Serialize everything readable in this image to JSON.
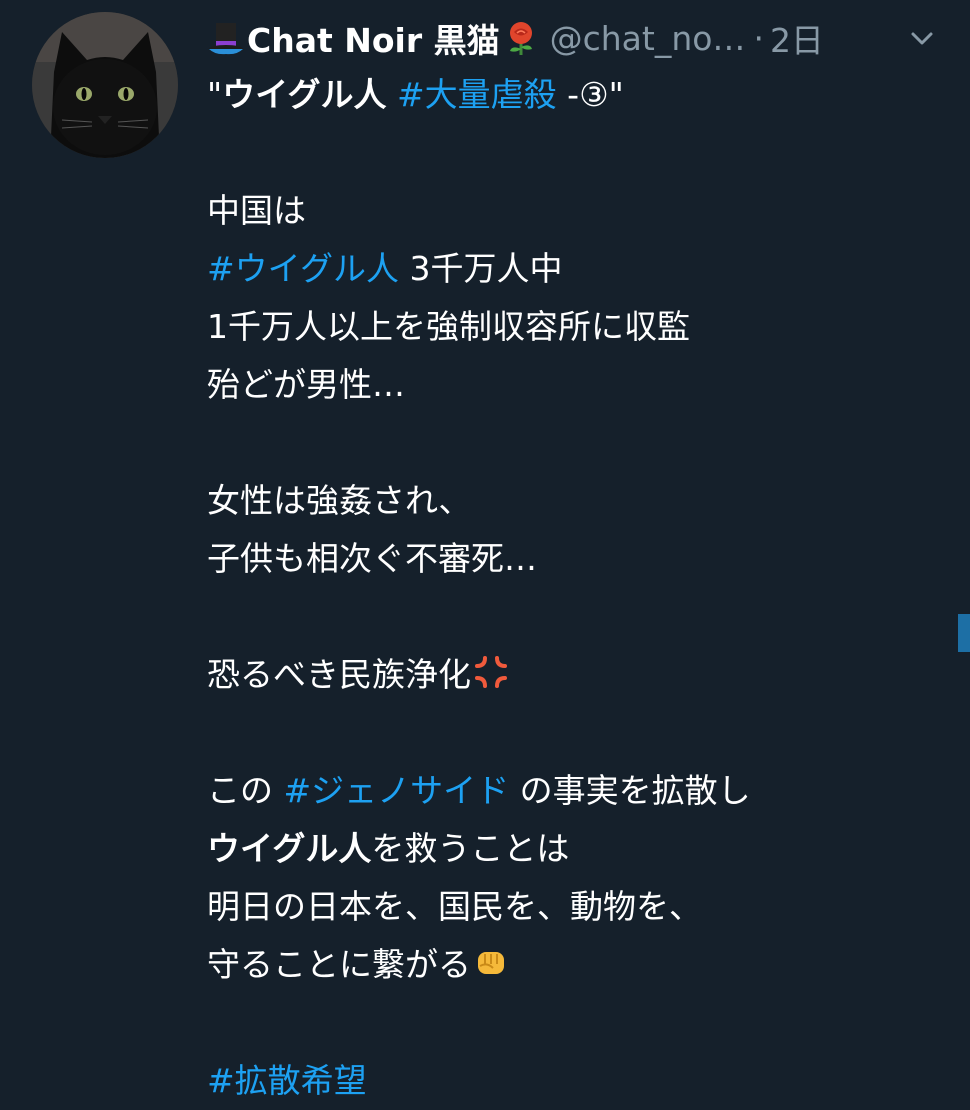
{
  "author": {
    "display_name": "Chat Noir 黒猫",
    "handle": "@chat_no…",
    "separator": "·",
    "time": "2日",
    "hat_icon": "top-hat-icon",
    "rose_icon": "rose-icon"
  },
  "tweet": {
    "title_quote_open": "\"",
    "title_bold": "ウイグル人",
    "title_hashtag": "#大量虐殺",
    "title_rest": " -③\"",
    "l1": "中国は",
    "l2_hashtag": "#ウイグル人",
    "l2_rest": " 3千万人中",
    "l3": "1千万人以上を強制収容所に収監",
    "l4": "殆どが男性…",
    "l5": "女性は強姦され、",
    "l6": "子供も相次ぐ不審死…",
    "l7": "恐るべき民族浄化",
    "l7_emoji": "anger-icon",
    "l8_pre": "この ",
    "l8_hashtag": "#ジェノサイド",
    "l8_rest": " の事実を拡散し",
    "l9_bold": "ウイグル人",
    "l9_rest": "を救うことは",
    "l10": "明日の日本を、国民を、動物を、",
    "l11": "守ることに繋がる",
    "l11_emoji": "fist-icon",
    "l12_hashtag": "#拡散希望"
  },
  "colors": {
    "background": "#15202b",
    "hashtag": "#1da1f2",
    "muted": "#8899a6"
  }
}
